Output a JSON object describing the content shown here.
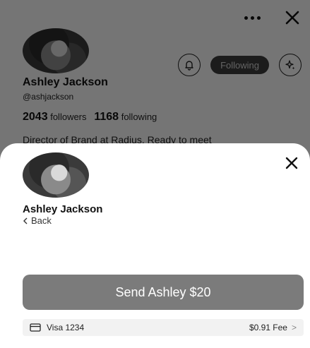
{
  "profile": {
    "name": "Ashley Jackson",
    "handle": "@ashjackson",
    "followers_count": "2043",
    "followers_label": "followers",
    "following_count": "1168",
    "following_label": "following",
    "bio": "Director of Brand at Radius. Ready to meet",
    "following_button": "Following"
  },
  "sheet": {
    "name": "Ashley Jackson",
    "back_label": "Back",
    "send_button": "Send Ashley $20",
    "payment_method": "Visa 1234",
    "fee": "$0.91 Fee",
    "fee_chevron": ">"
  },
  "icons": {
    "more": "more-dots-icon",
    "close": "close-icon",
    "bell": "bell-icon",
    "sparkle": "sparkle-icon",
    "card": "credit-card-icon",
    "back": "chevron-left-icon"
  },
  "colors": {
    "send_button_bg": "#7b7b7b",
    "following_bg": "#3b3b3b",
    "overlay": "rgba(0,0,0,0.52)"
  }
}
